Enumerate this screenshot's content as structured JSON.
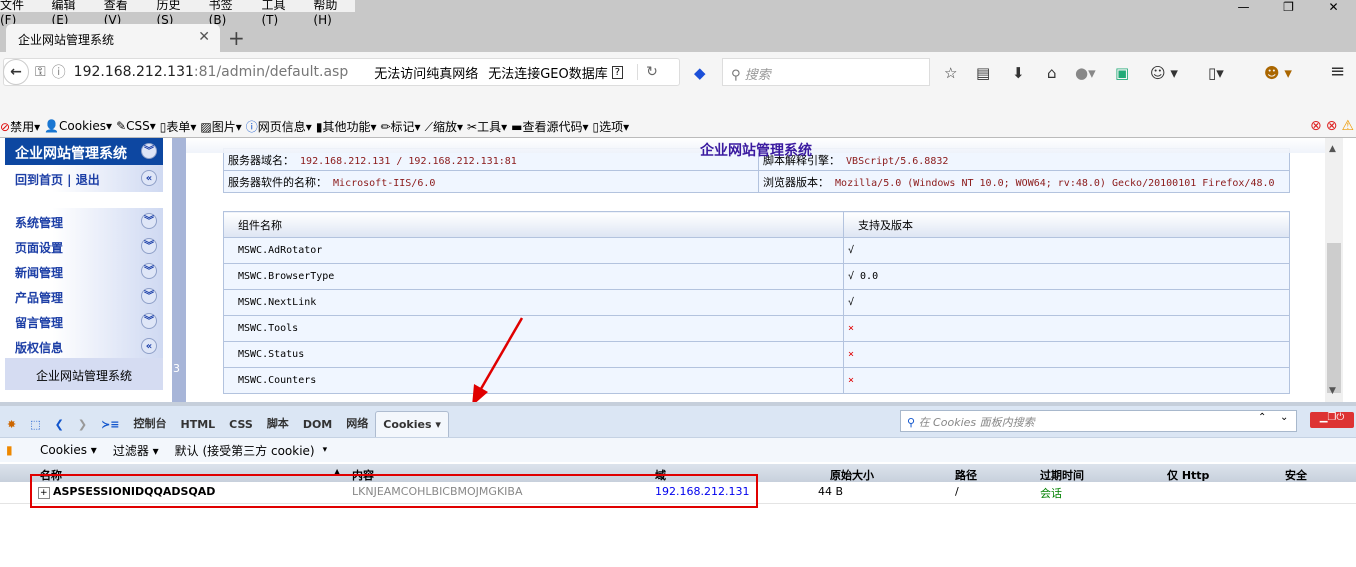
{
  "menubar": [
    "文件(F)",
    "编辑(E)",
    "查看(V)",
    "历史(S)",
    "书签(B)",
    "工具(T)",
    "帮助(H)"
  ],
  "tab": {
    "title": "企业网站管理系统"
  },
  "url": {
    "host": "192.168.212.131",
    "rest": ":81/admin/default.asp",
    "notice1": "无法访问纯真网络",
    "notice2": "无法连接GEO数据库",
    "help": "?"
  },
  "search": {
    "placeholder": "搜索"
  },
  "toolbar": [
    "禁用▾",
    "Cookies▾",
    "CSS▾",
    "表单▾",
    "图片▾",
    "网页信息▾",
    "其他功能▾",
    "标记▾",
    "缩放▾",
    "工具▾",
    "查看源代码▾",
    "选项▾"
  ],
  "sidebar": {
    "title": "企业网站管理系统",
    "home_logout": "回到首页 | 退出",
    "items": [
      "系统管理",
      "页面设置",
      "新闻管理",
      "产品管理",
      "留言管理",
      "版权信息"
    ],
    "footer": "企业网站管理系统"
  },
  "separator_text": "3",
  "page": {
    "title": "企业网站管理系统",
    "info": [
      {
        "label": "服务器域名：",
        "value": "192.168.212.131 / 192.168.212.131:81",
        "label2": "脚本解释引擎：",
        "value2": "VBScript/5.6.8832"
      },
      {
        "label": "服务器软件的名称：",
        "value": "Microsoft-IIS/6.0",
        "label2": "浏览器版本：",
        "value2": "Mozilla/5.0 (Windows NT 10.0; WOW64; rv:48.0) Gecko/20100101 Firefox/48.0"
      }
    ],
    "components_header": [
      "组件名称",
      "支持及版本"
    ],
    "components": [
      {
        "name": "MSWC.AdRotator",
        "support": "√",
        "ok": true
      },
      {
        "name": "MSWC.BrowserType",
        "support": "√ 0.0",
        "ok": true
      },
      {
        "name": "MSWC.NextLink",
        "support": "√",
        "ok": true
      },
      {
        "name": "MSWC.Tools",
        "support": "×",
        "ok": false
      },
      {
        "name": "MSWC.Status",
        "support": "×",
        "ok": false
      },
      {
        "name": "MSWC.Counters",
        "support": "×",
        "ok": false
      }
    ]
  },
  "devtools": {
    "tabs": [
      "控制台",
      "HTML",
      "CSS",
      "脚本",
      "DOM",
      "网络",
      "Cookies ▾"
    ],
    "active_tab": "Cookies",
    "search_placeholder": "在 Cookies 面板内搜索",
    "sub": [
      "Cookies ▾",
      "过滤器 ▾",
      "默认 (接受第三方 cookie)",
      "▾"
    ],
    "columns": [
      "名称",
      "内容",
      "域",
      "原始大小",
      "路径",
      "过期时间",
      "仅 Http",
      "安全"
    ],
    "cookies": [
      {
        "name": "ASPSESSIONIDQQADSQAD",
        "content": "LKNJEAMCOHLBICBMOJMGKIBA",
        "domain": "192.168.212.131",
        "size": "44 B",
        "path": "/",
        "expires": "会话",
        "httponly": "",
        "secure": ""
      }
    ]
  },
  "colors": {
    "sidebar_head": "#0d47a1",
    "annotation": "#e00000",
    "session": "#008000",
    "domain": "#0000ee"
  }
}
